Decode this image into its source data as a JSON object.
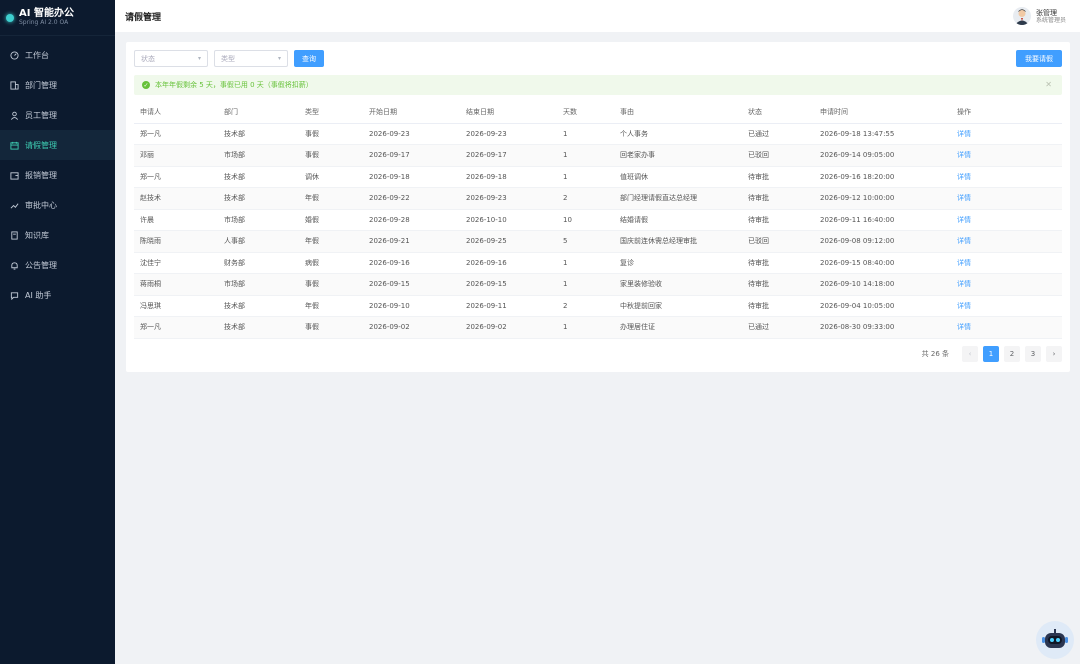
{
  "brand": {
    "title": "AI 智能办公",
    "subtitle": "Spring AI 2.0 OA"
  },
  "menu": [
    {
      "label": "工作台",
      "icon": "dashboard-icon",
      "active": false
    },
    {
      "label": "部门管理",
      "icon": "department-icon",
      "active": false
    },
    {
      "label": "员工管理",
      "icon": "user-icon",
      "active": false
    },
    {
      "label": "请假管理",
      "icon": "calendar-icon",
      "active": true
    },
    {
      "label": "报销管理",
      "icon": "wallet-icon",
      "active": false
    },
    {
      "label": "审批中心",
      "icon": "approval-icon",
      "active": false
    },
    {
      "label": "知识库",
      "icon": "book-icon",
      "active": false
    },
    {
      "label": "公告管理",
      "icon": "bell-icon",
      "active": false
    },
    {
      "label": "AI 助手",
      "icon": "chat-icon",
      "active": false
    }
  ],
  "header": {
    "title": "请假管理",
    "user_name": "张管理",
    "user_role": "系统管理员"
  },
  "filters": {
    "status_placeholder": "状态",
    "type_placeholder": "类型",
    "query_label": "查询",
    "apply_label": "我要请假"
  },
  "alert": {
    "text": "本年年假剩余 5 天，事假已用 0 天（事假将扣薪）"
  },
  "table": {
    "columns": [
      "申请人",
      "部门",
      "类型",
      "开始日期",
      "结束日期",
      "天数",
      "事由",
      "状态",
      "申请时间",
      "操作"
    ],
    "rows": [
      [
        "郑一凡",
        "技术部",
        "事假",
        "2026-09-23",
        "2026-09-23",
        "1",
        "个人事务",
        "已通过",
        "2026-09-18 13:47:55",
        "详情"
      ],
      [
        "邓丽",
        "市场部",
        "事假",
        "2026-09-17",
        "2026-09-17",
        "1",
        "回老家办事",
        "已驳回",
        "2026-09-14 09:05:00",
        "详情"
      ],
      [
        "郑一凡",
        "技术部",
        "调休",
        "2026-09-18",
        "2026-09-18",
        "1",
        "值班调休",
        "待审批",
        "2026-09-16 18:20:00",
        "详情"
      ],
      [
        "赵技术",
        "技术部",
        "年假",
        "2026-09-22",
        "2026-09-23",
        "2",
        "部门经理请假直达总经理",
        "待审批",
        "2026-09-12 10:00:00",
        "详情"
      ],
      [
        "许晨",
        "市场部",
        "婚假",
        "2026-09-28",
        "2026-10-10",
        "10",
        "结婚请假",
        "待审批",
        "2026-09-11 16:40:00",
        "详情"
      ],
      [
        "陈晓雨",
        "人事部",
        "年假",
        "2026-09-21",
        "2026-09-25",
        "5",
        "国庆前连休需总经理审批",
        "已驳回",
        "2026-09-08 09:12:00",
        "详情"
      ],
      [
        "沈佳宁",
        "财务部",
        "病假",
        "2026-09-16",
        "2026-09-16",
        "1",
        "复诊",
        "待审批",
        "2026-09-15 08:40:00",
        "详情"
      ],
      [
        "蒋雨桐",
        "市场部",
        "事假",
        "2026-09-15",
        "2026-09-15",
        "1",
        "家里装修验收",
        "待审批",
        "2026-09-10 14:18:00",
        "详情"
      ],
      [
        "冯思琪",
        "技术部",
        "年假",
        "2026-09-10",
        "2026-09-11",
        "2",
        "中秋提前回家",
        "待审批",
        "2026-09-04 10:05:00",
        "详情"
      ],
      [
        "郑一凡",
        "技术部",
        "事假",
        "2026-09-02",
        "2026-09-02",
        "1",
        "办理居住证",
        "已通过",
        "2026-08-30 09:33:00",
        "详情"
      ]
    ]
  },
  "pagination": {
    "total": "共 26 条",
    "prev": "‹",
    "next": "›",
    "pages": [
      "1",
      "2",
      "3"
    ],
    "current": "1"
  },
  "colors": {
    "sidebar_bg": "#0c1a2e",
    "accent": "#409eff",
    "active_menu": "#3ecfb4",
    "success": "#67c23a"
  }
}
